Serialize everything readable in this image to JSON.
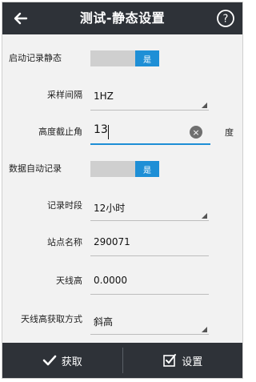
{
  "header": {
    "title": "测试-静态设置",
    "back_icon": "arrow-left-icon",
    "help_icon": "question-circle-icon",
    "help_label": "?"
  },
  "rows": {
    "start_static": {
      "label": "启动记录静态",
      "toggle_text": "是"
    },
    "sample_interval": {
      "label": "采样间隔",
      "value": "1HZ"
    },
    "cutoff_angle": {
      "label": "高度截止角",
      "value": "13",
      "unit": "度"
    },
    "auto_record": {
      "label": "数据自动记录",
      "toggle_text": "是"
    },
    "record_period": {
      "label": "记录时段",
      "value": "12小时"
    },
    "station_name": {
      "label": "站点名称",
      "value": "290071"
    },
    "antenna_height": {
      "label": "天线高",
      "value": "0.0000"
    },
    "antenna_method": {
      "label": "天线高获取方式",
      "value": "斜高"
    }
  },
  "footer": {
    "get_label": "获取",
    "set_label": "设置"
  },
  "colors": {
    "bar": "#2e3238",
    "accent": "#1e8fd6"
  }
}
